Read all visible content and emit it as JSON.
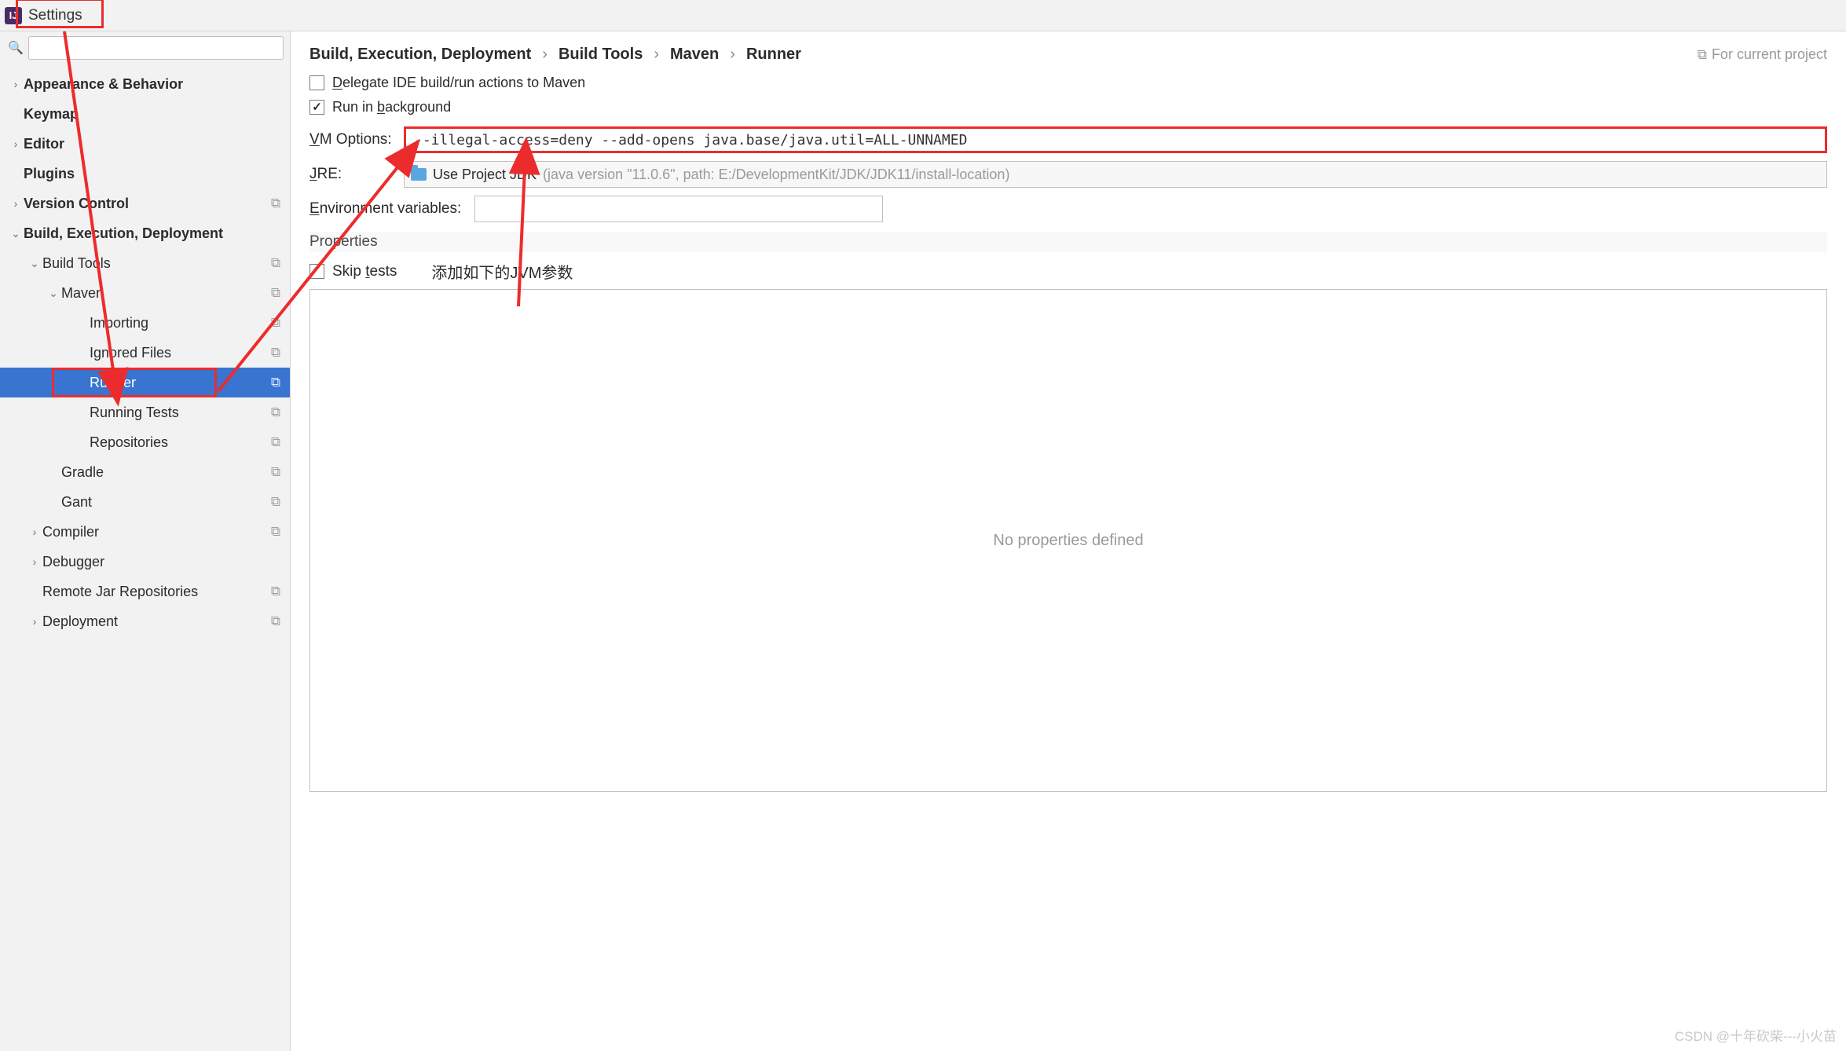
{
  "window": {
    "title": "Settings"
  },
  "sidebar": {
    "search_placeholder": "",
    "items": [
      {
        "label": "Appearance & Behavior",
        "chev": "›",
        "bold": true,
        "badge": false,
        "indent": 0
      },
      {
        "label": "Keymap",
        "chev": "",
        "bold": true,
        "badge": false,
        "indent": 0,
        "pad": true
      },
      {
        "label": "Editor",
        "chev": "›",
        "bold": true,
        "badge": false,
        "indent": 0
      },
      {
        "label": "Plugins",
        "chev": "",
        "bold": true,
        "badge": false,
        "indent": 0,
        "pad": true
      },
      {
        "label": "Version Control",
        "chev": "›",
        "bold": true,
        "badge": true,
        "indent": 0
      },
      {
        "label": "Build, Execution, Deployment",
        "chev": "⌄",
        "bold": true,
        "badge": false,
        "indent": 0
      },
      {
        "label": "Build Tools",
        "chev": "⌄",
        "bold": false,
        "badge": true,
        "indent": 1
      },
      {
        "label": "Maven",
        "chev": "⌄",
        "bold": false,
        "badge": true,
        "indent": 2
      },
      {
        "label": "Importing",
        "chev": "",
        "bold": false,
        "badge": true,
        "indent": 3
      },
      {
        "label": "Ignored Files",
        "chev": "",
        "bold": false,
        "badge": true,
        "indent": 3
      },
      {
        "label": "Runner",
        "chev": "",
        "bold": false,
        "badge": true,
        "indent": 3,
        "selected": true,
        "redbox": true
      },
      {
        "label": "Running Tests",
        "chev": "",
        "bold": false,
        "badge": true,
        "indent": 3
      },
      {
        "label": "Repositories",
        "chev": "",
        "bold": false,
        "badge": true,
        "indent": 3
      },
      {
        "label": "Gradle",
        "chev": "",
        "bold": false,
        "badge": true,
        "indent": 2
      },
      {
        "label": "Gant",
        "chev": "",
        "bold": false,
        "badge": true,
        "indent": 2
      },
      {
        "label": "Compiler",
        "chev": "›",
        "bold": false,
        "badge": true,
        "indent": 1
      },
      {
        "label": "Debugger",
        "chev": "›",
        "bold": false,
        "badge": false,
        "indent": 1
      },
      {
        "label": "Remote Jar Repositories",
        "chev": "",
        "bold": false,
        "badge": true,
        "indent": 1,
        "pad": true
      },
      {
        "label": "Deployment",
        "chev": "›",
        "bold": false,
        "badge": true,
        "indent": 1
      }
    ]
  },
  "breadcrumb": [
    "Build, Execution, Deployment",
    "Build Tools",
    "Maven",
    "Runner"
  ],
  "for_project": "For current project",
  "form": {
    "delegate_label": "Delegate IDE build/run actions to Maven",
    "delegate_checked": false,
    "run_bg_label": "Run in background",
    "run_bg_checked": true,
    "vm_label": "VM Options:",
    "vm_value": "--illegal-access=deny --add-opens java.base/java.util=ALL-UNNAMED",
    "jre_label": "JRE:",
    "jre_main": "Use Project JDK",
    "jre_gray": " (java version \"11.0.6\", path: E:/DevelopmentKit/JDK/JDK11/install-location)",
    "env_label": "Environment variables:",
    "props_title": "Properties",
    "skip_label": "Skip tests",
    "skip_checked": false,
    "annotation": "添加如下的JVM参数",
    "no_props": "No properties defined"
  },
  "watermark": "CSDN @十年砍柴---小火苗"
}
